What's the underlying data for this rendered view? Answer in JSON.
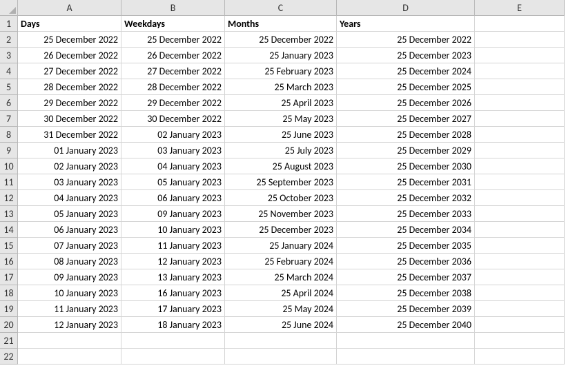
{
  "columns": [
    "A",
    "B",
    "C",
    "D",
    "E"
  ],
  "rowCount": 22,
  "headers": {
    "A": "Days",
    "B": "Weekdays",
    "C": "Months",
    "D": "Years",
    "E": ""
  },
  "data": {
    "A": [
      "25 December 2022",
      "26 December 2022",
      "27 December 2022",
      "28 December 2022",
      "29 December 2022",
      "30 December 2022",
      "31 December 2022",
      "01 January 2023",
      "02 January 2023",
      "03 January 2023",
      "04 January 2023",
      "05 January 2023",
      "06 January 2023",
      "07 January 2023",
      "08 January 2023",
      "09 January 2023",
      "10 January 2023",
      "11 January 2023",
      "12 January 2023"
    ],
    "B": [
      "25 December 2022",
      "26 December 2022",
      "27 December 2022",
      "28 December 2022",
      "29 December 2022",
      "30 December 2022",
      "02 January 2023",
      "03 January 2023",
      "04 January 2023",
      "05 January 2023",
      "06 January 2023",
      "09 January 2023",
      "10 January 2023",
      "11 January 2023",
      "12 January 2023",
      "13 January 2023",
      "16 January 2023",
      "17 January 2023",
      "18 January 2023"
    ],
    "C": [
      "25 December 2022",
      "25 January 2023",
      "25 February 2023",
      "25 March 2023",
      "25 April 2023",
      "25 May 2023",
      "25 June 2023",
      "25 July 2023",
      "25 August 2023",
      "25 September 2023",
      "25 October 2023",
      "25 November 2023",
      "25 December 2023",
      "25 January 2024",
      "25 February 2024",
      "25 March 2024",
      "25 April 2024",
      "25 May 2024",
      "25 June 2024"
    ],
    "D": [
      "25 December 2022",
      "25 December 2023",
      "25 December 2024",
      "25 December 2025",
      "25 December 2026",
      "25 December 2027",
      "25 December 2028",
      "25 December 2029",
      "25 December 2030",
      "25 December 2031",
      "25 December 2032",
      "25 December 2033",
      "25 December 2034",
      "25 December 2035",
      "25 December 2036",
      "25 December 2037",
      "25 December 2038",
      "25 December 2039",
      "25 December 2040"
    ]
  },
  "chart_data": {
    "type": "table",
    "title": "",
    "columns": [
      "Days",
      "Weekdays",
      "Months",
      "Years"
    ],
    "rows": [
      [
        "25 December 2022",
        "25 December 2022",
        "25 December 2022",
        "25 December 2022"
      ],
      [
        "26 December 2022",
        "26 December 2022",
        "25 January 2023",
        "25 December 2023"
      ],
      [
        "27 December 2022",
        "27 December 2022",
        "25 February 2023",
        "25 December 2024"
      ],
      [
        "28 December 2022",
        "28 December 2022",
        "25 March 2023",
        "25 December 2025"
      ],
      [
        "29 December 2022",
        "29 December 2022",
        "25 April 2023",
        "25 December 2026"
      ],
      [
        "30 December 2022",
        "30 December 2022",
        "25 May 2023",
        "25 December 2027"
      ],
      [
        "31 December 2022",
        "02 January 2023",
        "25 June 2023",
        "25 December 2028"
      ],
      [
        "01 January 2023",
        "03 January 2023",
        "25 July 2023",
        "25 December 2029"
      ],
      [
        "02 January 2023",
        "04 January 2023",
        "25 August 2023",
        "25 December 2030"
      ],
      [
        "03 January 2023",
        "05 January 2023",
        "25 September 2023",
        "25 December 2031"
      ],
      [
        "04 January 2023",
        "06 January 2023",
        "25 October 2023",
        "25 December 2032"
      ],
      [
        "05 January 2023",
        "09 January 2023",
        "25 November 2023",
        "25 December 2033"
      ],
      [
        "06 January 2023",
        "10 January 2023",
        "25 December 2023",
        "25 December 2034"
      ],
      [
        "07 January 2023",
        "11 January 2023",
        "25 January 2024",
        "25 December 2035"
      ],
      [
        "08 January 2023",
        "12 January 2023",
        "25 February 2024",
        "25 December 2036"
      ],
      [
        "09 January 2023",
        "13 January 2023",
        "25 March 2024",
        "25 December 2037"
      ],
      [
        "10 January 2023",
        "16 January 2023",
        "25 April 2024",
        "25 December 2038"
      ],
      [
        "11 January 2023",
        "17 January 2023",
        "25 May 2024",
        "25 December 2039"
      ],
      [
        "12 January 2023",
        "18 January 2023",
        "25 June 2024",
        "25 December 2040"
      ]
    ]
  }
}
